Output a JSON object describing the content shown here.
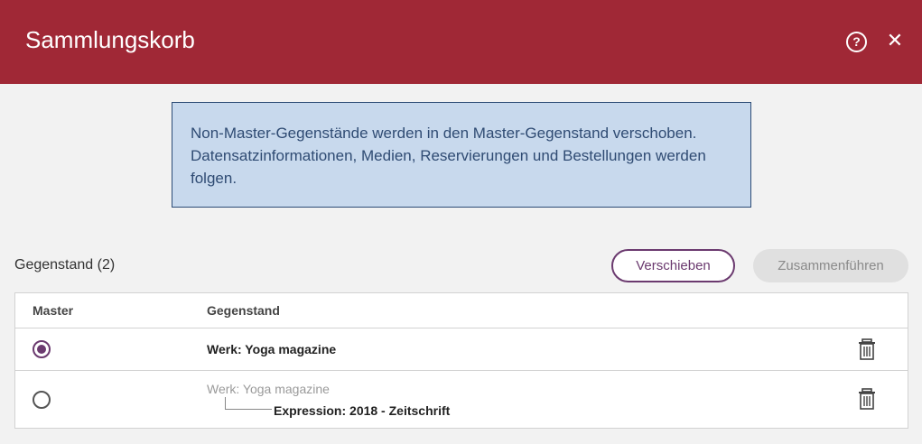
{
  "dialog": {
    "title": "Sammlungskorb",
    "help_icon": "?",
    "close_icon": "✕"
  },
  "info": {
    "message": "Non-Master-Gegenstände werden in den Master-Gegenstand verschoben. Datensatzinformationen, Medien, Reservierungen und Bestellungen werden folgen."
  },
  "toolbar": {
    "count_label": "Gegenstand (2)",
    "move_label": "Verschieben",
    "merge_label": "Zusammenführen"
  },
  "table": {
    "headers": {
      "master": "Master",
      "item": "Gegenstand"
    },
    "rows": [
      {
        "master": true,
        "title": "Werk: Yoga magazine"
      },
      {
        "master": false,
        "parent": "Werk: Yoga magazine",
        "child": "Expression: 2018 - Zeitschrift"
      }
    ]
  },
  "colors": {
    "header_bg": "#a02836",
    "accent": "#6b3a6f",
    "info_bg": "#c8d9ed"
  }
}
